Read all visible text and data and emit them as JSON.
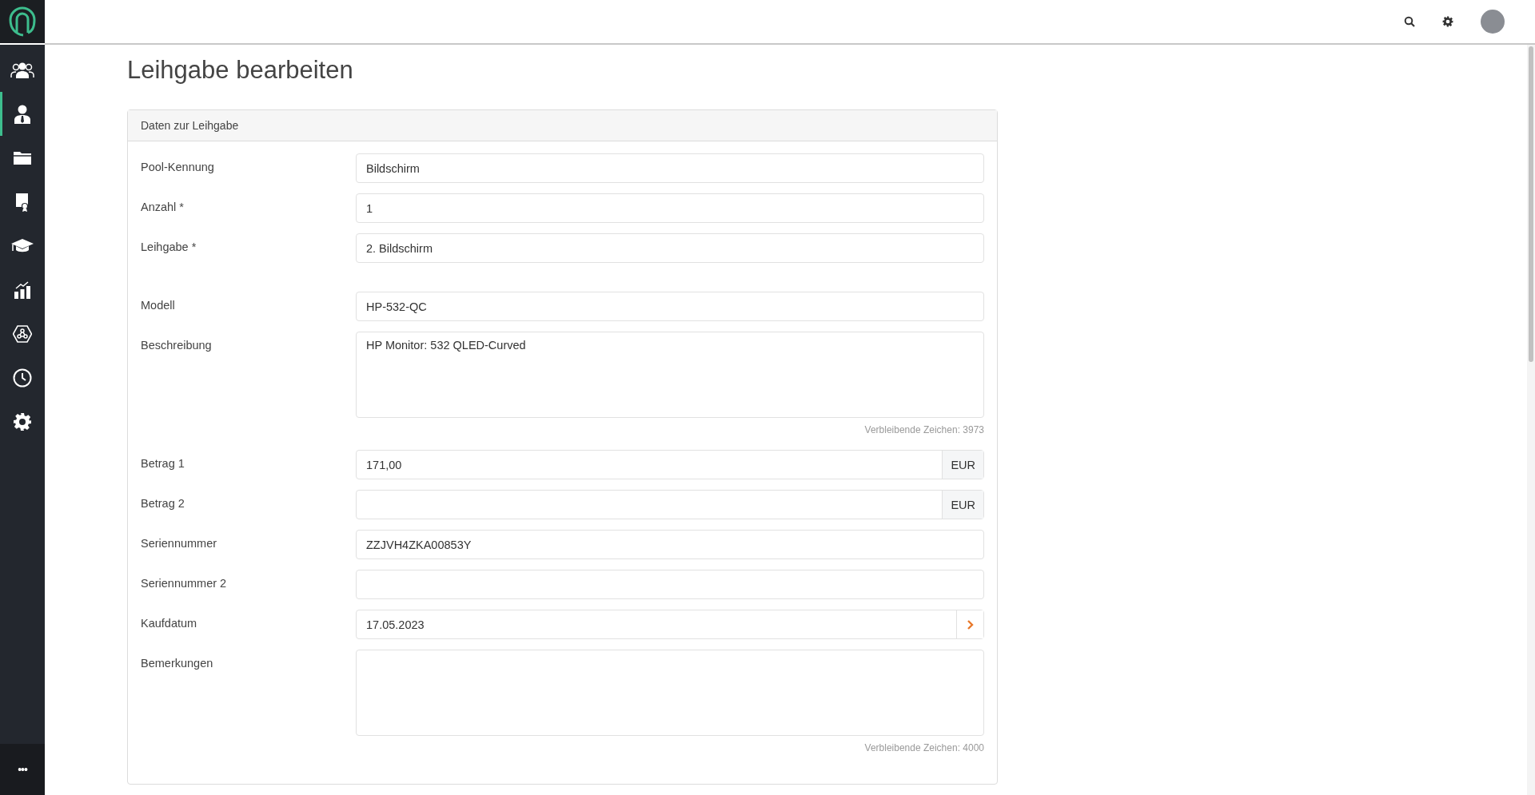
{
  "sidebar": {
    "items": [
      {
        "kind": "team",
        "selected": false
      },
      {
        "kind": "person",
        "selected": true
      },
      {
        "kind": "folder",
        "selected": false
      },
      {
        "kind": "certificate",
        "selected": false
      },
      {
        "kind": "graduation",
        "selected": false
      },
      {
        "kind": "chart",
        "selected": false
      },
      {
        "kind": "network",
        "selected": false
      },
      {
        "kind": "clock",
        "selected": false
      },
      {
        "kind": "settings",
        "selected": false
      }
    ],
    "more": "•••"
  },
  "page_title": "Leihgabe bearbeiten",
  "card": {
    "title": "Daten zur Leihgabe",
    "groups": [
      [
        {
          "kind": "text",
          "label": "Pool-Kennung",
          "value": "Bildschirm"
        },
        {
          "kind": "text",
          "label": "Anzahl *",
          "value": "1"
        },
        {
          "kind": "text",
          "label": "Leihgabe *",
          "value": "2. Bildschirm"
        }
      ],
      [
        {
          "kind": "text",
          "label": "Modell",
          "value": "HP-532-QC"
        },
        {
          "kind": "textarea",
          "label": "Beschreibung",
          "value": "HP Monitor: 532 QLED-Curved",
          "counter": "Verbleibende Zeichen: 3973"
        },
        {
          "kind": "currency",
          "label": "Betrag 1",
          "value": "171,00",
          "suffix": "EUR"
        },
        {
          "kind": "currency",
          "label": "Betrag 2",
          "suffix": "EUR"
        },
        {
          "kind": "text",
          "label": "Seriennummer",
          "value": "ZZJVH4ZKA00853Y"
        },
        {
          "kind": "text",
          "label": "Seriennummer 2"
        },
        {
          "kind": "date",
          "label": "Kaufdatum",
          "value": "17.05.2023"
        },
        {
          "kind": "textarea",
          "label": "Bemerkungen",
          "counter": "Verbleibende Zeichen: 4000"
        }
      ]
    ]
  }
}
